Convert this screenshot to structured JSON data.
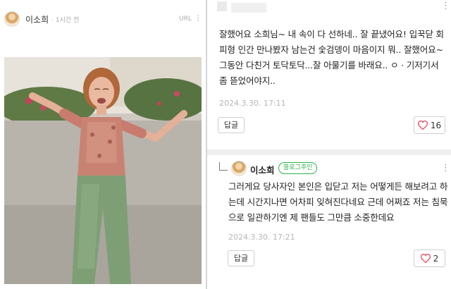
{
  "post": {
    "author": "이소희",
    "time": "· 1시간 전",
    "url_label": "URL",
    "menu_glyph": "⋮"
  },
  "comment": {
    "text": "잘했어요 소희님~ 내 속이 다 선하네.. 잘 끝냈어요! 입꾹닫 회피형 인간 만나봤자 남는건 숯검뎅이 마음이지 뭐.. 잘했어요~ 그동안 다친거 토닥토닥...잘 아물기를 바래요.. ㅇ · 기저기서 좀 뜯었어야지..",
    "date": "2024.3.30.  17:11",
    "reply_label": "답글",
    "like_count": "16",
    "menu_glyph": "⋮"
  },
  "reply": {
    "author": "이소희",
    "badge": "블로그주인",
    "text": "그러게요 당사자인 본인은 입닫고 저는 어떻게든 해보려고 하는데 시간지나면 어차피 잊혀진다네요 근데 어쩌죠 저는 침묵으로 일관하기엔 제 팬들도 그만큼 소중한데요",
    "date": "2024.3.30.  17:21",
    "reply_label": "답글",
    "like_count": "2",
    "menu_glyph": "⋮"
  },
  "colors": {
    "badge_green": "#2bb24c",
    "heart_red": "#e84a5f",
    "date_gray": "#b7b7b7"
  },
  "icons": {
    "heart": "heart-icon",
    "reply_arrow": "reply-arrow-icon",
    "more": "more-vertical-icon"
  }
}
